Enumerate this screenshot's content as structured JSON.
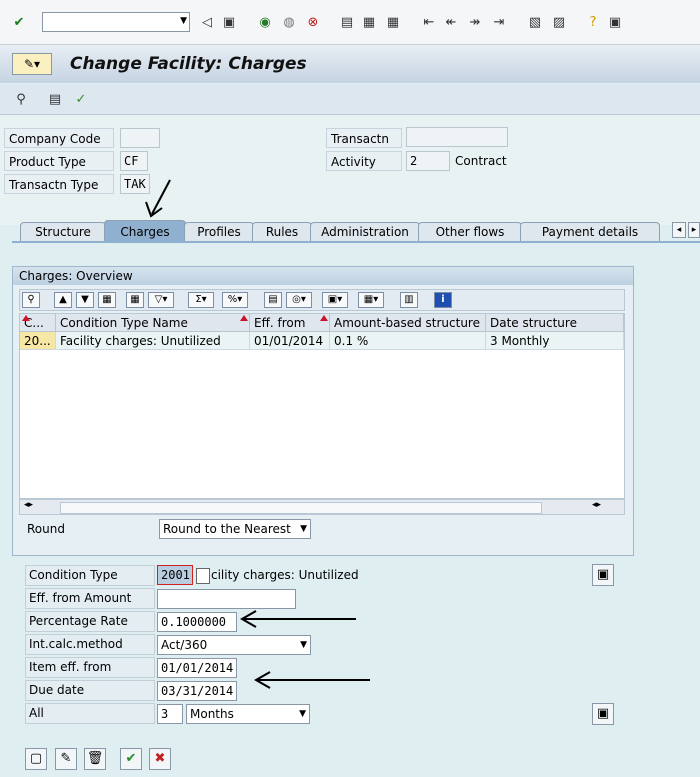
{
  "command_field": {
    "value": ""
  },
  "title": "Change Facility: Charges",
  "header": {
    "company_code": {
      "label": "Company Code",
      "value": ""
    },
    "product_type": {
      "label": "Product Type",
      "value": "CF"
    },
    "transactn_type": {
      "label": "Transactn Type",
      "value": "TAK"
    },
    "transactn": {
      "label": "Transactn",
      "value": ""
    },
    "activity": {
      "label": "Activity",
      "value": "2",
      "text": "Contract"
    }
  },
  "tabs": [
    {
      "label": "Structure"
    },
    {
      "label": "Charges",
      "active": true
    },
    {
      "label": "Profiles"
    },
    {
      "label": "Rules"
    },
    {
      "label": "Administration"
    },
    {
      "label": "Other flows"
    },
    {
      "label": "Payment details"
    }
  ],
  "overview": {
    "title": "Charges: Overview",
    "columns": [
      "C...",
      "Condition Type Name",
      "Eff. from",
      "Amount-based structure",
      "Date structure"
    ],
    "rows": [
      {
        "c": "20...",
        "name": "Facility charges: Unutilized",
        "eff_from": "01/01/2014",
        "amount_structure": "0.1 %",
        "date_structure": "3 Monthly"
      }
    ],
    "round": {
      "label": "Round",
      "value": "Round to the Nearest"
    }
  },
  "detail": {
    "condition_type": {
      "label": "Condition Type",
      "code": "2001",
      "text": "cility charges: Unutilized"
    },
    "eff_from_amount": {
      "label": "Eff. from Amount",
      "value": ""
    },
    "percentage_rate": {
      "label": "Percentage Rate",
      "value": "0.1000000"
    },
    "int_calc_method": {
      "label": "Int.calc.method",
      "value": "Act/360"
    },
    "item_eff_from": {
      "label": "Item eff. from",
      "value": "01/01/2014"
    },
    "due_date": {
      "label": "Due date",
      "value": "03/31/2014"
    },
    "all": {
      "label": "All",
      "number": "3",
      "unit": "Months"
    }
  },
  "colors": {
    "active_tab": "#8fb0cf",
    "title_gradient_top": "#e8eef4",
    "body_bg": "#dfeef0",
    "arrow": "#000000"
  }
}
